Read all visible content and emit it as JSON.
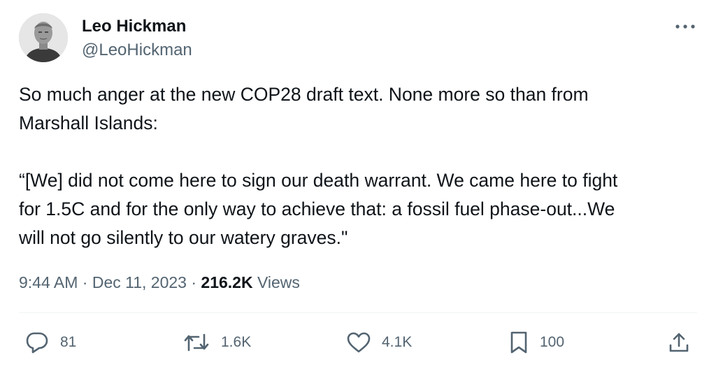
{
  "author": {
    "display_name": "Leo Hickman",
    "handle": "@LeoHickman",
    "avatar_icon": "user-photo-avatar"
  },
  "tweet": {
    "text": "So much anger at the new COP28 draft text. None more so than from\nMarshall Islands:\n\n“[We] did not come here to sign our death warrant. We came here to fight\nfor 1.5C and for the only way to achieve that: a fossil fuel phase-out...We\nwill not go silently to our watery graves.\""
  },
  "meta": {
    "time": "9:44 AM",
    "separator": " · ",
    "date": "Dec 11, 2023",
    "views_count": "216.2K",
    "views_label": " Views"
  },
  "actions": {
    "replies": "81",
    "reposts": "1.6K",
    "likes": "4.1K",
    "bookmarks": "100"
  },
  "icons": {
    "more": "more-horizontal-icon",
    "reply": "reply-bubble-icon",
    "repost": "repost-arrows-icon",
    "like": "heart-icon",
    "bookmark": "bookmark-icon",
    "share": "share-upload-icon"
  },
  "colors": {
    "text_primary": "#0f1419",
    "text_secondary": "#536471",
    "divider": "#eff3f4"
  }
}
